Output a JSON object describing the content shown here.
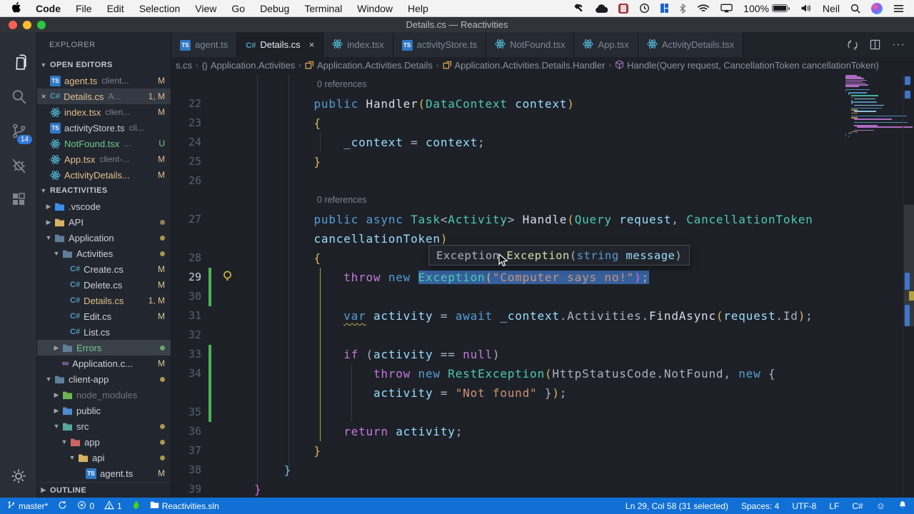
{
  "menubar": {
    "items": [
      "Code",
      "File",
      "Edit",
      "Selection",
      "View",
      "Go",
      "Debug",
      "Terminal",
      "Window",
      "Help"
    ],
    "bold_item": "Code",
    "battery": "100%",
    "user": "Neil"
  },
  "window": {
    "title": "Details.cs — Reactivities"
  },
  "tabs": [
    {
      "icon": "ts",
      "label": "agent.ts"
    },
    {
      "icon": "cs",
      "label": "Details.cs",
      "active": true,
      "close": "×"
    },
    {
      "icon": "react",
      "label": "index.tsx"
    },
    {
      "icon": "ts",
      "label": "activityStore.ts"
    },
    {
      "icon": "react",
      "label": "NotFound.tsx"
    },
    {
      "icon": "react",
      "label": "App.tsx"
    },
    {
      "icon": "react",
      "label": "ActivityDetails.tsx"
    }
  ],
  "breadcrumbs": [
    {
      "icon": null,
      "label": "s.cs"
    },
    {
      "icon": "braces",
      "label": "Application.Activities"
    },
    {
      "icon": "class",
      "label": "Application.Activities.Details"
    },
    {
      "icon": "class",
      "label": "Application.Activities.Details.Handler"
    },
    {
      "icon": "method",
      "label": "Handle(Query request, CancellationToken cancellationToken)"
    }
  ],
  "sidebar": {
    "explorer_title": "EXPLORER",
    "open_editors_label": "OPEN EDITORS",
    "project_label": "REACTIVITIES",
    "outline_label": "OUTLINE",
    "scm_badge": "14",
    "open_editors": [
      {
        "i": "ts",
        "l": "agent.ts",
        "d": "client...",
        "lc": "mod",
        "b": "M",
        "bc": "mod"
      },
      {
        "i": "cs",
        "l": "Details.cs",
        "d": "A...",
        "lc": "mod",
        "b": "1, M",
        "bc": "mod",
        "active": true,
        "close": "×"
      },
      {
        "i": "react",
        "l": "index.tsx",
        "d": "clien...",
        "lc": "mod",
        "b": "M",
        "bc": "mod"
      },
      {
        "i": "ts",
        "l": "activityStore.ts",
        "d": "cli...",
        "lc": "",
        "b": "",
        "bc": ""
      },
      {
        "i": "react",
        "l": "NotFound.tsx",
        "d": "...",
        "lc": "green",
        "b": "U",
        "bc": "green"
      },
      {
        "i": "react",
        "l": "App.tsx",
        "d": "client-...",
        "lc": "mod",
        "b": "M",
        "bc": "mod"
      },
      {
        "i": "react",
        "l": "ActivityDetails...",
        "d": "",
        "lc": "mod",
        "b": "M",
        "bc": "mod"
      }
    ],
    "tree": [
      {
        "ind": 0,
        "a": "c",
        "i": "folder",
        "c": "#3b8eea",
        "l": ".vscode"
      },
      {
        "ind": 0,
        "a": "c",
        "i": "folder",
        "c": "#d8b263",
        "l": "API",
        "dot": "#8f8255"
      },
      {
        "ind": 0,
        "a": "e",
        "i": "folder",
        "c": "#5f7e97",
        "l": "Application",
        "dot": "#a89550"
      },
      {
        "ind": 1,
        "a": "e",
        "i": "folder",
        "c": "#5f7e97",
        "l": "Activities",
        "dot": "#a89550"
      },
      {
        "ind": 2,
        "i": "cs",
        "l": "Create.cs",
        "b": "M"
      },
      {
        "ind": 2,
        "i": "cs",
        "l": "Delete.cs",
        "b": "M"
      },
      {
        "ind": 2,
        "i": "cs",
        "l": "Details.cs",
        "lc": "mod",
        "b": "1, M",
        "bc": "mod"
      },
      {
        "ind": 2,
        "i": "cs",
        "l": "Edit.cs",
        "b": "M"
      },
      {
        "ind": 2,
        "i": "cs",
        "l": "List.cs"
      },
      {
        "ind": 1,
        "a": "c",
        "i": "folder",
        "c": "#5f7e97",
        "l": "Errors",
        "lc": "green",
        "dot": "#69a56f",
        "sel": true
      },
      {
        "ind": 1,
        "i": "vs",
        "l": "Application.c...",
        "b": "M"
      },
      {
        "ind": 0,
        "a": "e",
        "i": "folder",
        "c": "#5f7e97",
        "l": "client-app",
        "dot": "#a89550"
      },
      {
        "ind": 1,
        "a": "c",
        "i": "folder",
        "c": "#6fb352",
        "l": "node_modules",
        "lc": "dim"
      },
      {
        "ind": 1,
        "a": "c",
        "i": "folder",
        "c": "#4f8bd0",
        "l": "public"
      },
      {
        "ind": 1,
        "a": "e",
        "i": "folder",
        "c": "#56a89c",
        "l": "src",
        "dot": "#a89550"
      },
      {
        "ind": 2,
        "a": "e",
        "i": "folder",
        "c": "#cc6666",
        "l": "app",
        "dot": "#a89550"
      },
      {
        "ind": 3,
        "a": "e",
        "i": "folder",
        "c": "#d8b263",
        "l": "api",
        "dot": "#a89550"
      },
      {
        "ind": 4,
        "i": "ts",
        "l": "agent.ts",
        "b": "M"
      }
    ]
  },
  "code": {
    "codelens_label": "0 references",
    "lines": [
      {
        "t": "lens"
      },
      {
        "t": "c",
        "n": "22",
        "ind": 8,
        "tk": [
          [
            "kw",
            "public"
          ],
          [
            "pl",
            " "
          ],
          [
            "fn",
            "Handler"
          ],
          [
            "b1",
            "("
          ],
          [
            "ty",
            "DataContext"
          ],
          [
            "pl",
            " "
          ],
          [
            "vr",
            "context"
          ],
          [
            "b1",
            ")"
          ]
        ]
      },
      {
        "t": "c",
        "n": "23",
        "ind": 8,
        "tk": [
          [
            "b1",
            "{"
          ]
        ]
      },
      {
        "t": "c",
        "n": "24",
        "ind": 12,
        "tk": [
          [
            "vr",
            "_context"
          ],
          [
            "pl",
            " = "
          ],
          [
            "vr",
            "context"
          ],
          [
            "pl",
            ";"
          ]
        ]
      },
      {
        "t": "c",
        "n": "25",
        "ind": 8,
        "tk": [
          [
            "b1",
            "}"
          ]
        ]
      },
      {
        "t": "c",
        "n": "26",
        "ind": 0,
        "tk": []
      },
      {
        "t": "lens"
      },
      {
        "t": "c",
        "n": "27",
        "ind": 8,
        "tk": [
          [
            "kw",
            "public"
          ],
          [
            "pl",
            " "
          ],
          [
            "kw",
            "async"
          ],
          [
            "pl",
            " "
          ],
          [
            "ty",
            "Task"
          ],
          [
            "pl",
            "<"
          ],
          [
            "ty",
            "Activity"
          ],
          [
            "pl",
            "> "
          ],
          [
            "fn",
            "Handle"
          ],
          [
            "b1",
            "("
          ],
          [
            "ty",
            "Query"
          ],
          [
            "pl",
            " "
          ],
          [
            "vr",
            "request"
          ],
          [
            "pl",
            ", "
          ],
          [
            "ty",
            "CancellationToken"
          ]
        ]
      },
      {
        "t": "c",
        "n": "",
        "ind": 8,
        "tk": [
          [
            "vr",
            "cancellationToken"
          ],
          [
            "b1",
            ")"
          ]
        ]
      },
      {
        "t": "c",
        "n": "28",
        "ind": 8,
        "tk": [
          [
            "b1",
            "{"
          ]
        ]
      },
      {
        "t": "c",
        "n": "29",
        "ind": 12,
        "green": true,
        "bulb": true,
        "cur": true,
        "tk": [
          [
            "ctl",
            "throw"
          ],
          [
            "pl",
            " "
          ],
          [
            "kw",
            "new"
          ],
          [
            "pl",
            " "
          ],
          [
            "ty sel",
            "Exception"
          ],
          [
            "b1 sel",
            "("
          ],
          [
            "str sel",
            "\"Computer says no!\""
          ],
          [
            "b3 sel",
            ")"
          ],
          [
            "pl sel",
            ";"
          ]
        ]
      },
      {
        "t": "c",
        "n": "30",
        "ind": 0,
        "green": true,
        "tk": []
      },
      {
        "t": "c",
        "n": "31",
        "ind": 12,
        "tk": [
          [
            "kw sq",
            "var"
          ],
          [
            "pl",
            " "
          ],
          [
            "vr",
            "activity"
          ],
          [
            "pl",
            " = "
          ],
          [
            "kw",
            "await"
          ],
          [
            "pl",
            " "
          ],
          [
            "vr",
            "_context"
          ],
          [
            "pl",
            ".Activities."
          ],
          [
            "fn",
            "FindAsync"
          ],
          [
            "b1",
            "("
          ],
          [
            "vr",
            "request"
          ],
          [
            "pl",
            ".Id"
          ],
          [
            "b1",
            ")"
          ],
          [
            "pl",
            ";"
          ]
        ]
      },
      {
        "t": "c",
        "n": "32",
        "ind": 0,
        "tk": []
      },
      {
        "t": "c",
        "n": "33",
        "ind": 12,
        "green": true,
        "tk": [
          [
            "ctl",
            "if"
          ],
          [
            "pl",
            " ("
          ],
          [
            "vr",
            "activity"
          ],
          [
            "pl",
            " == "
          ],
          [
            "ctl",
            "null"
          ],
          [
            "pl",
            ")"
          ]
        ]
      },
      {
        "t": "c",
        "n": "34",
        "ind": 16,
        "green": true,
        "tk": [
          [
            "ctl",
            "throw"
          ],
          [
            "pl",
            " "
          ],
          [
            "kw",
            "new"
          ],
          [
            "pl",
            " "
          ],
          [
            "ty",
            "RestException"
          ],
          [
            "b1",
            "("
          ],
          [
            "pl",
            "HttpStatusCode.NotFound"
          ],
          [
            "pl",
            ", "
          ],
          [
            "kw",
            "new"
          ],
          [
            "pl",
            " {"
          ]
        ]
      },
      {
        "t": "c",
        "n": "",
        "ind": 16,
        "green": true,
        "tk": [
          [
            "vr",
            "activity"
          ],
          [
            "pl",
            " = "
          ],
          [
            "str",
            "\"Not found\""
          ],
          [
            "pl",
            " }"
          ],
          [
            "b1",
            ")"
          ],
          [
            "pl",
            ";"
          ]
        ]
      },
      {
        "t": "c",
        "n": "35",
        "ind": 0,
        "green": true,
        "tk": []
      },
      {
        "t": "c",
        "n": "36",
        "ind": 12,
        "tk": [
          [
            "ctl",
            "return"
          ],
          [
            "pl",
            " "
          ],
          [
            "vr",
            "activity"
          ],
          [
            "pl",
            ";"
          ]
        ]
      },
      {
        "t": "c",
        "n": "37",
        "ind": 8,
        "tk": [
          [
            "b1",
            "}"
          ]
        ]
      },
      {
        "t": "c",
        "n": "38",
        "ind": 4,
        "tk": [
          [
            "b2",
            "}"
          ]
        ]
      },
      {
        "t": "c",
        "n": "39",
        "ind": 0,
        "tk": [
          [
            "b3",
            "}"
          ]
        ]
      }
    ]
  },
  "tooltip": {
    "tokens": [
      [
        "pl",
        "Exception"
      ],
      [
        "pl",
        "."
      ],
      [
        "fny",
        "Exception"
      ],
      [
        "pl",
        "("
      ],
      [
        "kw",
        "string"
      ],
      [
        "pl",
        " "
      ],
      [
        "vr",
        "message"
      ],
      [
        "pl",
        ")"
      ]
    ]
  },
  "statusbar": {
    "left": [
      {
        "icon": "branch",
        "label": "master*"
      },
      {
        "icon": "sync",
        "label": ""
      },
      {
        "icon": "error",
        "label": "0"
      },
      {
        "icon": "warning",
        "label": "1"
      },
      {
        "icon": "flame",
        "label": ""
      },
      {
        "icon": "folder",
        "label": "Reactivities.sln"
      }
    ],
    "right": [
      {
        "icon": null,
        "label": "Ln 29, Col 58 (31 selected)"
      },
      {
        "icon": null,
        "label": "Spaces: 4"
      },
      {
        "icon": null,
        "label": "UTF-8"
      },
      {
        "icon": null,
        "label": "LF"
      },
      {
        "icon": null,
        "label": "C#"
      },
      {
        "icon": "smiley",
        "label": ""
      },
      {
        "icon": "bell",
        "label": ""
      }
    ]
  }
}
